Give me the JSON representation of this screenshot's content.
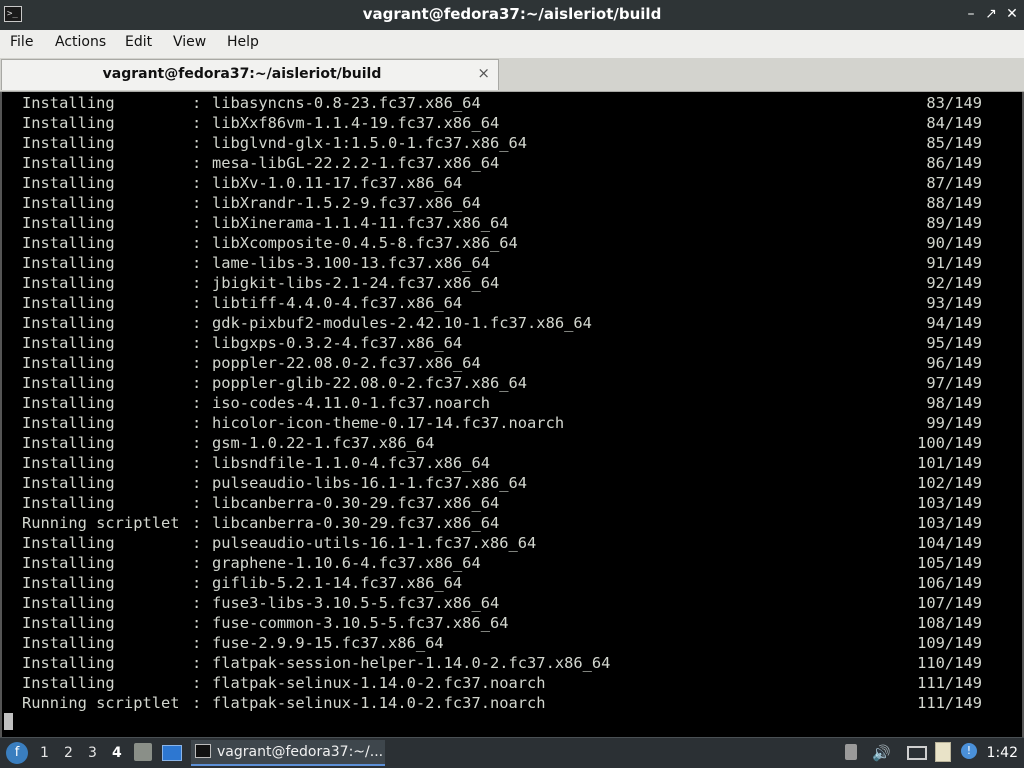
{
  "window": {
    "title": "vagrant@fedora37:~/aisleriot/build",
    "app_icon": "terminal-icon",
    "buttons": {
      "minimize": "minimize-icon",
      "maximize": "maximize-icon",
      "close": "close-icon"
    }
  },
  "menu": [
    "File",
    "Actions",
    "Edit",
    "View",
    "Help"
  ],
  "tab": {
    "label": "vagrant@fedora37:~/aisleriot/build",
    "close": "×"
  },
  "terminal": {
    "lines": [
      {
        "action": "Installing",
        "pkg": "libasyncns-0.8-23.fc37.x86_64",
        "count": "83/149"
      },
      {
        "action": "Installing",
        "pkg": "libXxf86vm-1.1.4-19.fc37.x86_64",
        "count": "84/149"
      },
      {
        "action": "Installing",
        "pkg": "libglvnd-glx-1:1.5.0-1.fc37.x86_64",
        "count": "85/149"
      },
      {
        "action": "Installing",
        "pkg": "mesa-libGL-22.2.2-1.fc37.x86_64",
        "count": "86/149"
      },
      {
        "action": "Installing",
        "pkg": "libXv-1.0.11-17.fc37.x86_64",
        "count": "87/149"
      },
      {
        "action": "Installing",
        "pkg": "libXrandr-1.5.2-9.fc37.x86_64",
        "count": "88/149"
      },
      {
        "action": "Installing",
        "pkg": "libXinerama-1.1.4-11.fc37.x86_64",
        "count": "89/149"
      },
      {
        "action": "Installing",
        "pkg": "libXcomposite-0.4.5-8.fc37.x86_64",
        "count": "90/149"
      },
      {
        "action": "Installing",
        "pkg": "lame-libs-3.100-13.fc37.x86_64",
        "count": "91/149"
      },
      {
        "action": "Installing",
        "pkg": "jbigkit-libs-2.1-24.fc37.x86_64",
        "count": "92/149"
      },
      {
        "action": "Installing",
        "pkg": "libtiff-4.4.0-4.fc37.x86_64",
        "count": "93/149"
      },
      {
        "action": "Installing",
        "pkg": "gdk-pixbuf2-modules-2.42.10-1.fc37.x86_64",
        "count": "94/149"
      },
      {
        "action": "Installing",
        "pkg": "libgxps-0.3.2-4.fc37.x86_64",
        "count": "95/149"
      },
      {
        "action": "Installing",
        "pkg": "poppler-22.08.0-2.fc37.x86_64",
        "count": "96/149"
      },
      {
        "action": "Installing",
        "pkg": "poppler-glib-22.08.0-2.fc37.x86_64",
        "count": "97/149"
      },
      {
        "action": "Installing",
        "pkg": "iso-codes-4.11.0-1.fc37.noarch",
        "count": "98/149"
      },
      {
        "action": "Installing",
        "pkg": "hicolor-icon-theme-0.17-14.fc37.noarch",
        "count": "99/149"
      },
      {
        "action": "Installing",
        "pkg": "gsm-1.0.22-1.fc37.x86_64",
        "count": "100/149"
      },
      {
        "action": "Installing",
        "pkg": "libsndfile-1.1.0-4.fc37.x86_64",
        "count": "101/149"
      },
      {
        "action": "Installing",
        "pkg": "pulseaudio-libs-16.1-1.fc37.x86_64",
        "count": "102/149"
      },
      {
        "action": "Installing",
        "pkg": "libcanberra-0.30-29.fc37.x86_64",
        "count": "103/149"
      },
      {
        "action": "Running scriptlet",
        "pkg": "libcanberra-0.30-29.fc37.x86_64",
        "count": "103/149"
      },
      {
        "action": "Installing",
        "pkg": "pulseaudio-utils-16.1-1.fc37.x86_64",
        "count": "104/149"
      },
      {
        "action": "Installing",
        "pkg": "graphene-1.10.6-4.fc37.x86_64",
        "count": "105/149"
      },
      {
        "action": "Installing",
        "pkg": "giflib-5.2.1-14.fc37.x86_64",
        "count": "106/149"
      },
      {
        "action": "Installing",
        "pkg": "fuse3-libs-3.10.5-5.fc37.x86_64",
        "count": "107/149"
      },
      {
        "action": "Installing",
        "pkg": "fuse-common-3.10.5-5.fc37.x86_64",
        "count": "108/149"
      },
      {
        "action": "Installing",
        "pkg": "fuse-2.9.9-15.fc37.x86_64",
        "count": "109/149"
      },
      {
        "action": "Installing",
        "pkg": "flatpak-session-helper-1.14.0-2.fc37.x86_64",
        "count": "110/149"
      },
      {
        "action": "Installing",
        "pkg": "flatpak-selinux-1.14.0-2.fc37.noarch",
        "count": "111/149"
      },
      {
        "action": "Running scriptlet",
        "pkg": "flatpak-selinux-1.14.0-2.fc37.noarch",
        "count": "111/149"
      }
    ]
  },
  "taskbar": {
    "start_icon": "fedora-start-icon",
    "workspaces": [
      "1",
      "2",
      "3",
      "4"
    ],
    "active_workspace": "4",
    "quick_launch": [
      "file-manager-icon",
      "show-desktop-icon"
    ],
    "task": {
      "label": "vagrant@fedora37:~/...",
      "icon": "terminal-icon"
    },
    "tray": [
      "removable-media-icon",
      "volume-icon",
      "network-icon",
      "clipboard-icon",
      "notification-icon"
    ],
    "clock": "1:42"
  }
}
